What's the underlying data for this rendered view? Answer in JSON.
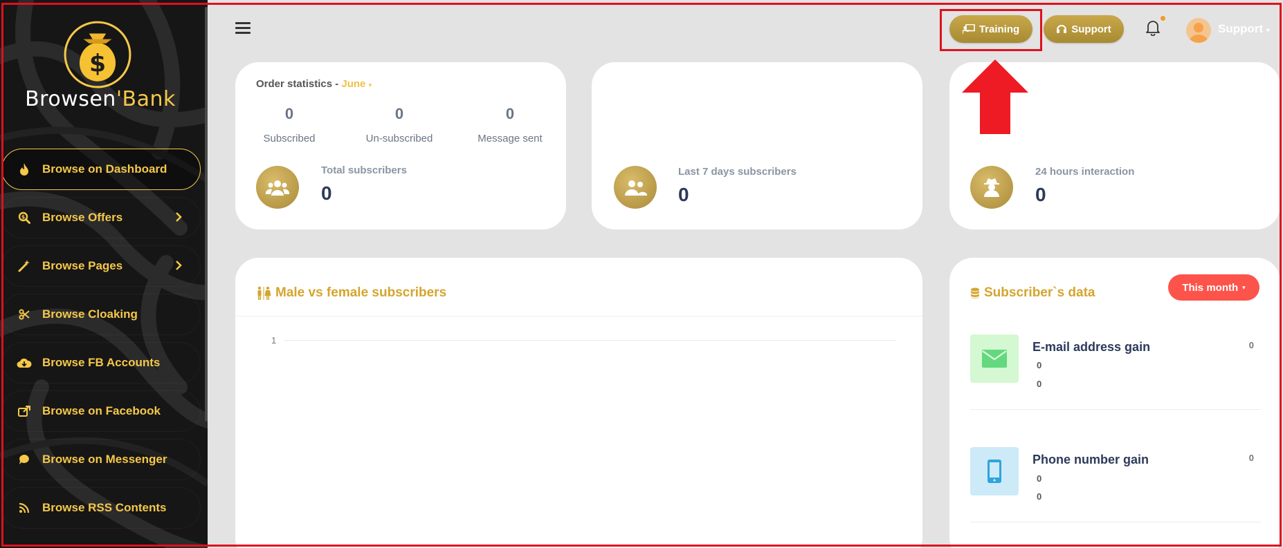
{
  "brand": {
    "name_part1": "Browsen",
    "name_part2": "'Bank"
  },
  "sidebar": {
    "items": [
      {
        "label": "Browse on Dashboard",
        "icon": "fire-icon",
        "active": true,
        "has_children": false
      },
      {
        "label": "Browse Offers",
        "icon": "search-dollar-icon",
        "active": false,
        "has_children": true
      },
      {
        "label": "Browse Pages",
        "icon": "magic-wand-icon",
        "active": false,
        "has_children": true
      },
      {
        "label": "Browse Cloaking",
        "icon": "scissors-icon",
        "active": false,
        "has_children": false
      },
      {
        "label": "Browse FB Accounts",
        "icon": "cloud-download-icon",
        "active": false,
        "has_children": false
      },
      {
        "label": "Browse on Facebook",
        "icon": "share-external-icon",
        "active": false,
        "has_children": false
      },
      {
        "label": "Browse on Messenger",
        "icon": "chat-bubble-icon",
        "active": false,
        "has_children": false
      },
      {
        "label": "Browse RSS Contents",
        "icon": "rss-icon",
        "active": false,
        "has_children": false
      }
    ]
  },
  "topbar": {
    "training_label": "Training",
    "support_label": "Support",
    "user_name": "Support"
  },
  "order_stats": {
    "title": "Order statistics - ",
    "month": "June",
    "subscribed": {
      "value": "0",
      "label": "Subscribed"
    },
    "unsubscribed": {
      "value": "0",
      "label": "Un-subscribed"
    },
    "message_sent": {
      "value": "0",
      "label": "Message sent"
    },
    "total_label": "Total subscribers",
    "total_value": "0"
  },
  "last7": {
    "label": "Last 7 days subscribers",
    "value": "0"
  },
  "interaction24": {
    "label": "24 hours interaction",
    "value": "0"
  },
  "gender_chart": {
    "title": "Male vs female subscribers",
    "tick": "1"
  },
  "subscriber_data": {
    "title": "Subscriber`s data",
    "filter_label": "This month",
    "email": {
      "title": "E-mail address gain",
      "count": "0",
      "sub1": "0",
      "sub2": "0"
    },
    "phone": {
      "title": "Phone number gain",
      "count": "0",
      "sub1": "0",
      "sub2": "0"
    }
  },
  "colors": {
    "gold": "#c9a84a",
    "accent_yellow": "#f5c84a",
    "red": "#fc544b",
    "highlight_red": "#e0101d"
  }
}
